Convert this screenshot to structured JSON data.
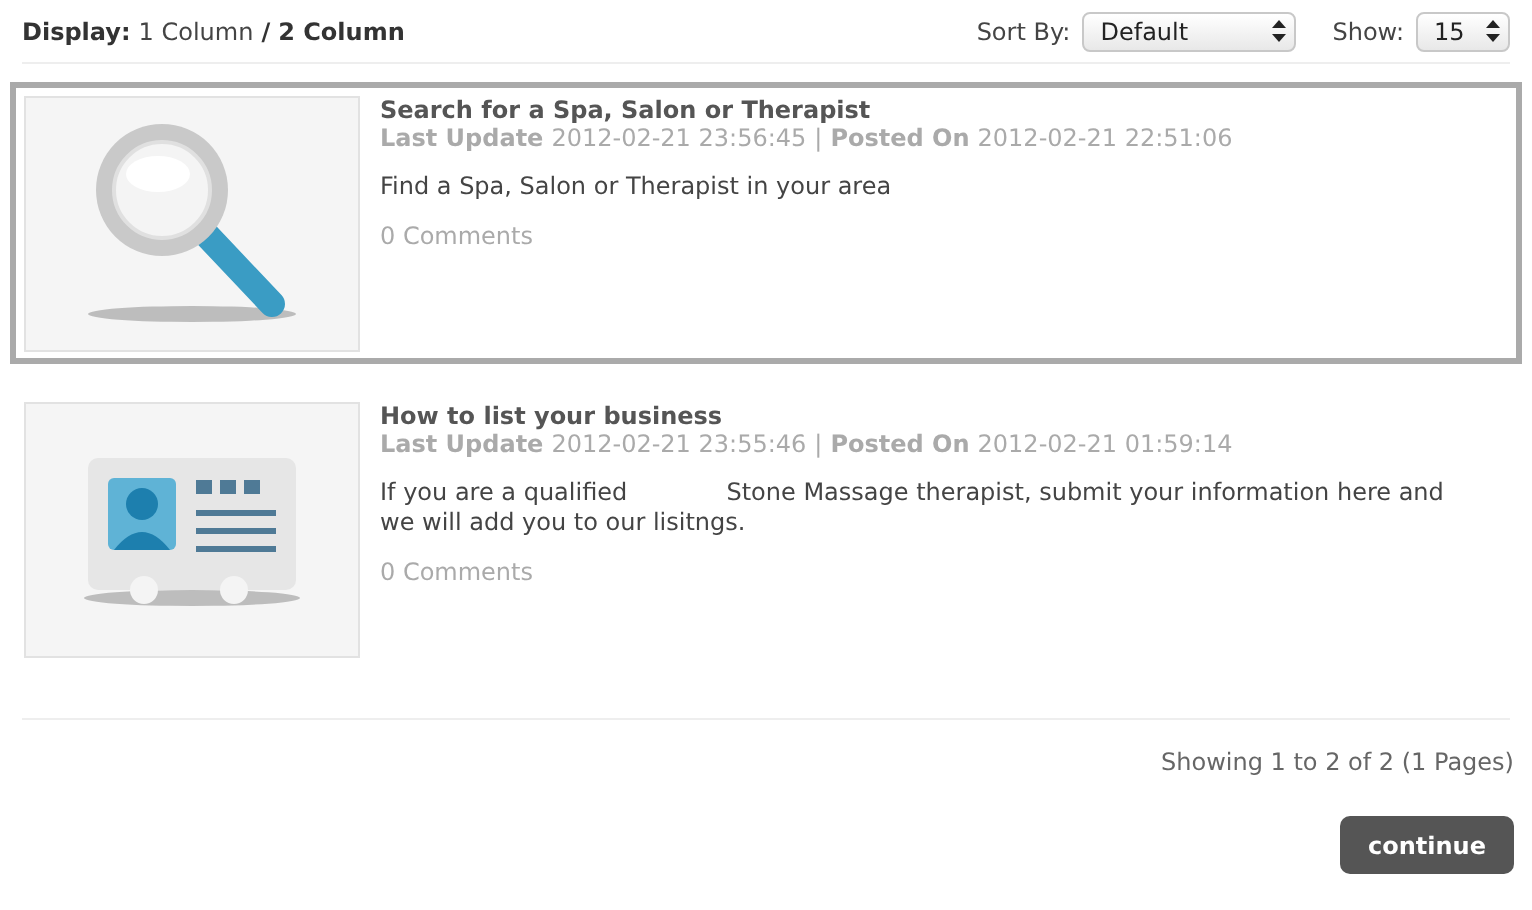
{
  "toolbar": {
    "display_label": "Display:",
    "display_options": [
      {
        "label": "1 Column",
        "selected": false
      },
      {
        "label": "2 Column",
        "selected": true
      }
    ],
    "separator": "/",
    "sort_label": "Sort By:",
    "sort_value": "Default",
    "show_label": "Show:",
    "show_value": "15"
  },
  "items": [
    {
      "kind": "magnifier",
      "selected": true,
      "title": "Search for a Spa, Salon or Therapist",
      "updated_label": "Last Update",
      "updated": "2012-02-21 23:56:45",
      "divider": "|",
      "posted_label": "Posted On",
      "posted": "2012-02-21 22:51:06",
      "description": "Find a Spa, Salon or Therapist in your area",
      "comments": "0 Comments"
    },
    {
      "kind": "contact-card",
      "selected": false,
      "title": "How to list your business",
      "updated_label": "Last Update",
      "updated": "2012-02-21 23:55:46",
      "divider": "|",
      "posted_label": "Posted On",
      "posted": "2012-02-21 01:59:14",
      "description": "If you are a qualified             Stone Massage therapist, submit your information here and we will add you to our lisitngs.",
      "comments": "0 Comments"
    }
  ],
  "pagination": "Showing 1 to 2 of 2 (1 Pages)",
  "continue_button": "continue"
}
